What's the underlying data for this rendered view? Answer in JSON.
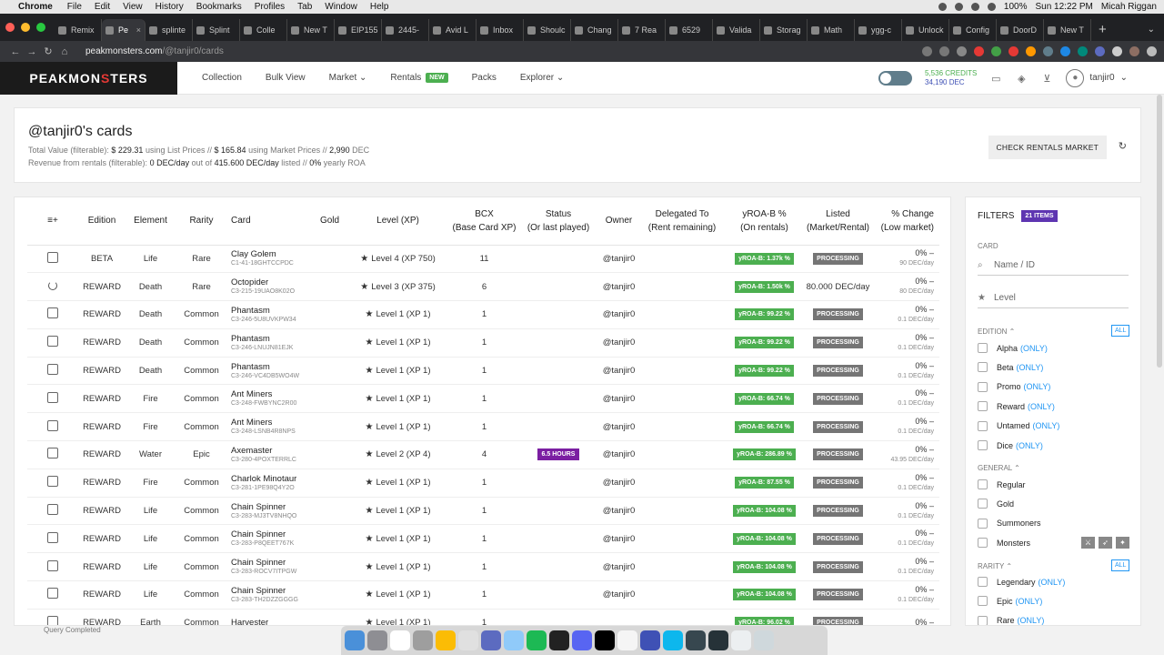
{
  "mac": {
    "app": "Chrome",
    "menus": [
      "File",
      "Edit",
      "View",
      "History",
      "Bookmarks",
      "Profiles",
      "Tab",
      "Window",
      "Help"
    ],
    "battery": "100%",
    "datetime": "Sun 12:22 PM",
    "user": "Micah Riggan"
  },
  "tabs": [
    "Remix",
    "Pe",
    "splinte",
    "Splint",
    "Colle",
    "New T",
    "EIP155",
    "2445-",
    "Avid L",
    "Inbox",
    "Shoulc",
    "Chang",
    "7 Rea",
    "6529",
    "Valida",
    "Storag",
    "Math",
    "ygg-c",
    "Unlock",
    "Config",
    "DoorD",
    "New T"
  ],
  "url": {
    "host": "peakmonsters.com",
    "path": "/@tanjir0/cards"
  },
  "brand": {
    "pre": "PEAKMON",
    "mid": "S",
    "post": "TERS"
  },
  "nav": {
    "collection": "Collection",
    "bulk": "Bulk View",
    "market": "Market",
    "rentals": "Rentals",
    "new_badge": "NEW",
    "packs": "Packs",
    "explorer": "Explorer"
  },
  "account": {
    "credits": "5,536 CREDITS",
    "dec": "34,190 DEC",
    "username": "tanjir0"
  },
  "summary": {
    "title": "@tanjir0's cards",
    "tv_label": "Total Value (filterable):",
    "tv_list": "$ 229.31",
    "tv_list_suffix": "using List Prices //",
    "tv_market": "$ 165.84",
    "tv_market_suffix": "using Market Prices //",
    "tv_dec": "2,990",
    "tv_dec_suffix": "DEC",
    "rev_label": "Revenue from rentals (filterable):",
    "rev_val": "0 DEC/day",
    "rev_mid": "out of",
    "rev_total": "415.600 DEC/day",
    "rev_listed": "listed //",
    "roa": "0%",
    "roa_suffix": "yearly ROA",
    "check_btn": "CHECK RENTALS MARKET"
  },
  "table": {
    "headers": {
      "sort": "≡+",
      "edition": "Edition",
      "element": "Element",
      "rarity": "Rarity",
      "card": "Card",
      "gold": "Gold",
      "level": "Level (XP)",
      "bcx": "BCX",
      "bcx2": "(Base Card XP)",
      "status": "Status",
      "status2": "(Or last played)",
      "owner": "Owner",
      "delegated": "Delegated To",
      "delegated2": "(Rent remaining)",
      "yroa": "yROA-B %",
      "yroa2": "(On rentals)",
      "listed": "Listed",
      "listed2": "(Market/Rental)",
      "change": "% Change",
      "change2": "(Low market)"
    },
    "rows": [
      {
        "edition": "BETA",
        "element": "Life",
        "rarity": "Rare",
        "name": "Clay Golem",
        "id": "C1-41-18GHTCCPDC",
        "level": "Level 4 (XP 750)",
        "bcx": "11",
        "status": "",
        "owner": "@tanjir0",
        "yroa": "yROA-B: 1.37k %",
        "listed": "PROCESSING",
        "pct": "0%",
        "pday": "90 DEC/day"
      },
      {
        "edition": "REWARD",
        "element": "Death",
        "rarity": "Rare",
        "name": "Octopider",
        "id": "C3-215-19UAO8K02O",
        "level": "Level 3 (XP 375)",
        "bcx": "6",
        "status": "",
        "owner": "@tanjir0",
        "yroa": "yROA-B: 1.50k %",
        "listed": "80.000 DEC/day",
        "pct": "0%",
        "pday": "80 DEC/day"
      },
      {
        "edition": "REWARD",
        "element": "Death",
        "rarity": "Common",
        "name": "Phantasm",
        "id": "C3-246-5U8UVKPW34",
        "level": "Level 1 (XP 1)",
        "bcx": "1",
        "status": "",
        "owner": "@tanjir0",
        "yroa": "yROA-B: 99.22 %",
        "listed": "PROCESSING",
        "pct": "0%",
        "pday": "0.1 DEC/day"
      },
      {
        "edition": "REWARD",
        "element": "Death",
        "rarity": "Common",
        "name": "Phantasm",
        "id": "C3-246-LNUJN81EJK",
        "level": "Level 1 (XP 1)",
        "bcx": "1",
        "status": "",
        "owner": "@tanjir0",
        "yroa": "yROA-B: 99.22 %",
        "listed": "PROCESSING",
        "pct": "0%",
        "pday": "0.1 DEC/day"
      },
      {
        "edition": "REWARD",
        "element": "Death",
        "rarity": "Common",
        "name": "Phantasm",
        "id": "C3-246-VC4DB5WO4W",
        "level": "Level 1 (XP 1)",
        "bcx": "1",
        "status": "",
        "owner": "@tanjir0",
        "yroa": "yROA-B: 99.22 %",
        "listed": "PROCESSING",
        "pct": "0%",
        "pday": "0.1 DEC/day"
      },
      {
        "edition": "REWARD",
        "element": "Fire",
        "rarity": "Common",
        "name": "Ant Miners",
        "id": "C3-248-FWBYNC2R00",
        "level": "Level 1 (XP 1)",
        "bcx": "1",
        "status": "",
        "owner": "@tanjir0",
        "yroa": "yROA-B: 66.74 %",
        "listed": "PROCESSING",
        "pct": "0%",
        "pday": "0.1 DEC/day"
      },
      {
        "edition": "REWARD",
        "element": "Fire",
        "rarity": "Common",
        "name": "Ant Miners",
        "id": "C3-248-LSNB4R8NPS",
        "level": "Level 1 (XP 1)",
        "bcx": "1",
        "status": "",
        "owner": "@tanjir0",
        "yroa": "yROA-B: 66.74 %",
        "listed": "PROCESSING",
        "pct": "0%",
        "pday": "0.1 DEC/day"
      },
      {
        "edition": "REWARD",
        "element": "Water",
        "rarity": "Epic",
        "name": "Axemaster",
        "id": "C3-280-4POXTERRLC",
        "level": "Level 2 (XP 4)",
        "bcx": "4",
        "status": "6.5 HOURS",
        "owner": "@tanjir0",
        "yroa": "yROA-B: 286.89 %",
        "listed": "PROCESSING",
        "pct": "0%",
        "pday": "43.95 DEC/day"
      },
      {
        "edition": "REWARD",
        "element": "Fire",
        "rarity": "Common",
        "name": "Charlok Minotaur",
        "id": "C3-281-1PE98Q4Y2O",
        "level": "Level 1 (XP 1)",
        "bcx": "1",
        "status": "",
        "owner": "@tanjir0",
        "yroa": "yROA-B: 87.55 %",
        "listed": "PROCESSING",
        "pct": "0%",
        "pday": "0.1 DEC/day"
      },
      {
        "edition": "REWARD",
        "element": "Life",
        "rarity": "Common",
        "name": "Chain Spinner",
        "id": "C3-283-MJ3TV8NHQO",
        "level": "Level 1 (XP 1)",
        "bcx": "1",
        "status": "",
        "owner": "@tanjir0",
        "yroa": "yROA-B: 104.08 %",
        "listed": "PROCESSING",
        "pct": "0%",
        "pday": "0.1 DEC/day"
      },
      {
        "edition": "REWARD",
        "element": "Life",
        "rarity": "Common",
        "name": "Chain Spinner",
        "id": "C3-283-P8QEET767K",
        "level": "Level 1 (XP 1)",
        "bcx": "1",
        "status": "",
        "owner": "@tanjir0",
        "yroa": "yROA-B: 104.08 %",
        "listed": "PROCESSING",
        "pct": "0%",
        "pday": "0.1 DEC/day"
      },
      {
        "edition": "REWARD",
        "element": "Life",
        "rarity": "Common",
        "name": "Chain Spinner",
        "id": "C3-283-ROCV7ITPGW",
        "level": "Level 1 (XP 1)",
        "bcx": "1",
        "status": "",
        "owner": "@tanjir0",
        "yroa": "yROA-B: 104.08 %",
        "listed": "PROCESSING",
        "pct": "0%",
        "pday": "0.1 DEC/day"
      },
      {
        "edition": "REWARD",
        "element": "Life",
        "rarity": "Common",
        "name": "Chain Spinner",
        "id": "C3-283-TH2DZZGGGG",
        "level": "Level 1 (XP 1)",
        "bcx": "1",
        "status": "",
        "owner": "@tanjir0",
        "yroa": "yROA-B: 104.08 %",
        "listed": "PROCESSING",
        "pct": "0%",
        "pday": "0.1 DEC/day"
      },
      {
        "edition": "REWARD",
        "element": "Earth",
        "rarity": "Common",
        "name": "Harvester",
        "id": "",
        "level": "Level 1 (XP 1)",
        "bcx": "1",
        "status": "",
        "owner": "",
        "yroa": "yROA-B: 96.02 %",
        "listed": "PROCESSING",
        "pct": "0%",
        "pday": ""
      }
    ]
  },
  "filters": {
    "title": "FILTERS",
    "items": "21 ITEMS",
    "card_label": "CARD",
    "name_ph": "Name / ID",
    "level_ph": "Level",
    "edition_label": "EDITION",
    "all": "ALL",
    "only": "(ONLY)",
    "editions": [
      "Alpha",
      "Beta",
      "Promo",
      "Reward",
      "Untamed",
      "Dice"
    ],
    "general_label": "GENERAL",
    "general": [
      "Regular",
      "Gold",
      "Summoners",
      "Monsters"
    ],
    "rarity_label": "RARITY",
    "rarities": [
      "Legendary",
      "Epic",
      "Rare"
    ]
  },
  "footer": {
    "query": "Query Completed"
  }
}
